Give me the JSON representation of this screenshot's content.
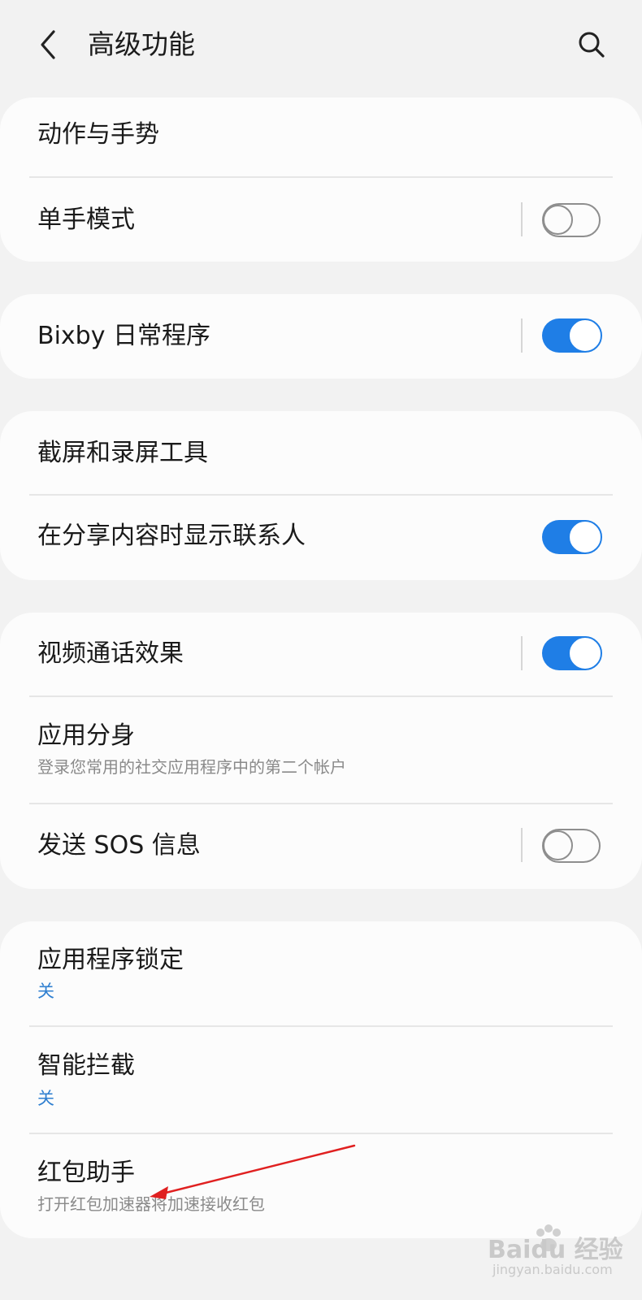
{
  "header": {
    "title": "高级功能",
    "back_icon": "back-arrow-icon",
    "search_icon": "search-icon"
  },
  "settings": [
    {
      "id": "motions",
      "title": "动作与手势"
    },
    {
      "id": "one-hand",
      "title": "单手模式",
      "toggle": false
    },
    {
      "id": "bixby",
      "title": "Bixby 日常程序",
      "toggle": true
    },
    {
      "id": "screenshot",
      "title": "截屏和录屏工具"
    },
    {
      "id": "share-contacts",
      "title": "在分享内容时显示联系人",
      "toggle": true
    },
    {
      "id": "video-call",
      "title": "视频通话效果",
      "toggle": true
    },
    {
      "id": "dual-app",
      "title": "应用分身",
      "subtitle": "登录您常用的社交应用程序中的第二个帐户"
    },
    {
      "id": "sos",
      "title": "发送 SOS 信息",
      "toggle": false
    },
    {
      "id": "app-lock",
      "title": "应用程序锁定",
      "subtitle": "关"
    },
    {
      "id": "smart-block",
      "title": "智能拦截",
      "subtitle": "关"
    },
    {
      "id": "red-packet",
      "title": "红包助手",
      "subtitle": "打开红包加速器将加速接收红包"
    }
  ],
  "colors": {
    "accent": "#1f7ee6",
    "annotation_arrow": "#e02020"
  },
  "watermark": {
    "text": "Baidu 经验",
    "sub": "jingyan.baidu.com"
  }
}
